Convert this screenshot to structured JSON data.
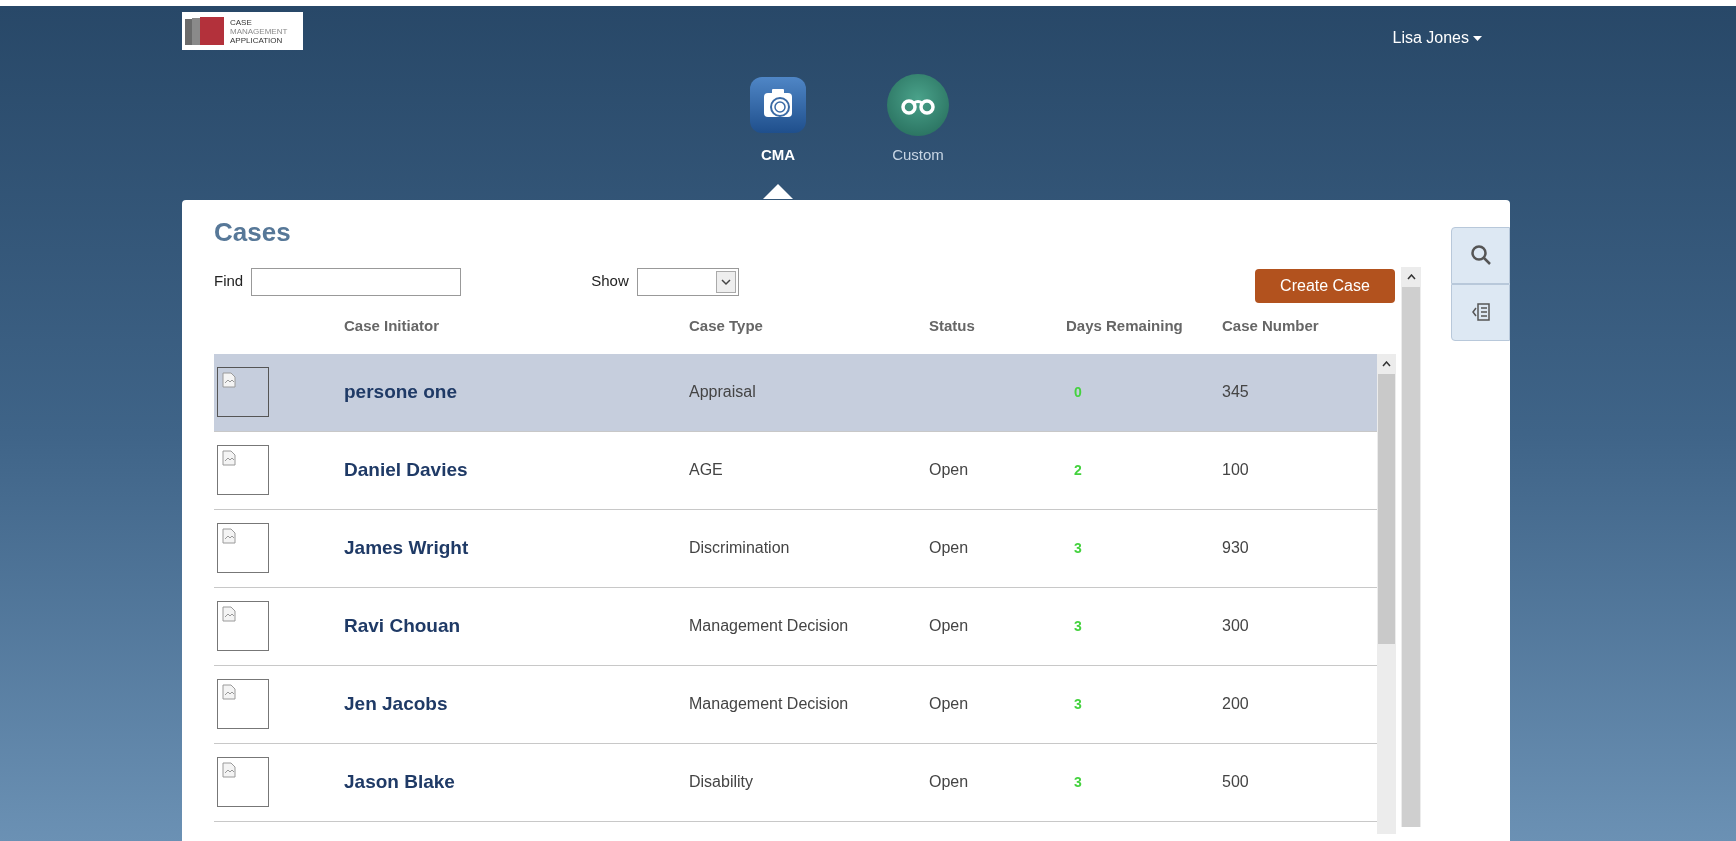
{
  "logo": {
    "lines": [
      "CASE",
      "MANAGEMENT",
      "APPLICATION"
    ]
  },
  "user_menu": {
    "label": "Lisa Jones"
  },
  "apps": [
    {
      "label": "CMA",
      "kind": "camera",
      "selected": true
    },
    {
      "label": "Custom",
      "kind": "glasses",
      "selected": false
    }
  ],
  "panel": {
    "title": "Cases",
    "find": {
      "label": "Find"
    },
    "show": {
      "label": "Show"
    },
    "create_button": "Create Case"
  },
  "table": {
    "columns": [
      "Case Initiator",
      "Case Type",
      "Status",
      "Days Remaining",
      "Case Number"
    ],
    "rows": [
      {
        "initiator": "persone one",
        "type": "Appraisal",
        "days": "0",
        "number": "345",
        "selected": true
      },
      {
        "initiator": "Daniel Davies",
        "type": "AGE",
        "status": "Open",
        "days": "2",
        "number": "100",
        "selected": false
      },
      {
        "initiator": "James Wright",
        "type": "Discrimination",
        "status": "Open",
        "days": "3",
        "number": "930",
        "selected": false
      },
      {
        "initiator": "Ravi Chouan",
        "type": "Management Decision",
        "status": "Open",
        "days": "3",
        "number": "300",
        "selected": false
      },
      {
        "initiator": "Jen Jacobs",
        "type": "Management Decision",
        "status": "Open",
        "days": "3",
        "number": "200",
        "selected": false
      },
      {
        "initiator": "Jason Blake",
        "type": "Disability",
        "status": "Open",
        "days": "3",
        "number": "500",
        "selected": false
      }
    ]
  }
}
